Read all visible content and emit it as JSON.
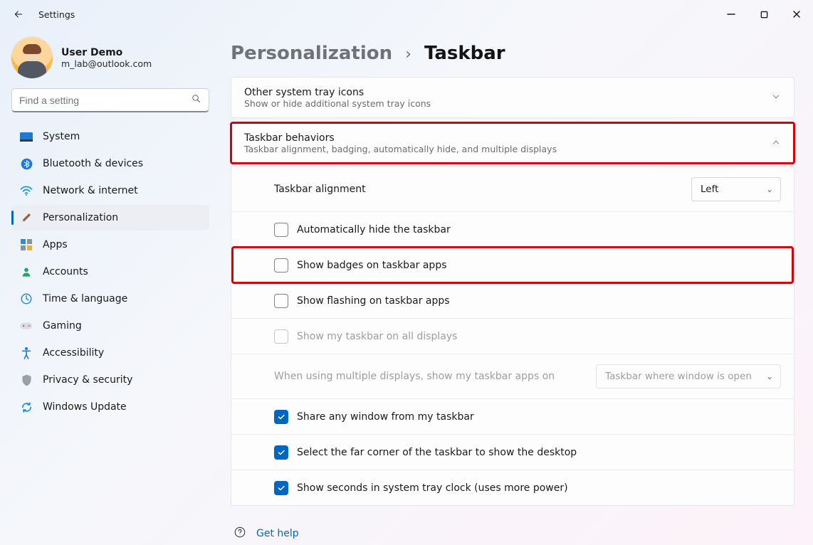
{
  "titlebar": {
    "app_title": "Settings"
  },
  "user": {
    "name": "User Demo",
    "email": "m_lab@outlook.com"
  },
  "search": {
    "placeholder": "Find a setting"
  },
  "sidebar": {
    "items": [
      {
        "label": "System"
      },
      {
        "label": "Bluetooth & devices"
      },
      {
        "label": "Network & internet"
      },
      {
        "label": "Personalization"
      },
      {
        "label": "Apps"
      },
      {
        "label": "Accounts"
      },
      {
        "label": "Time & language"
      },
      {
        "label": "Gaming"
      },
      {
        "label": "Accessibility"
      },
      {
        "label": "Privacy & security"
      },
      {
        "label": "Windows Update"
      }
    ]
  },
  "breadcrumb": {
    "parent": "Personalization",
    "current": "Taskbar"
  },
  "panels": {
    "systray": {
      "title": "Other system tray icons",
      "sub": "Show or hide additional system tray icons"
    },
    "behaviors": {
      "title": "Taskbar behaviors",
      "sub": "Taskbar alignment, badging, automatically hide, and multiple displays"
    }
  },
  "settings": {
    "alignment_label": "Taskbar alignment",
    "alignment_value": "Left",
    "auto_hide": "Automatically hide the taskbar",
    "badges": "Show badges on taskbar apps",
    "flashing": "Show flashing on taskbar apps",
    "all_displays": "Show my taskbar on all displays",
    "multi_label": "When using multiple displays, show my taskbar apps on",
    "multi_value": "Taskbar where window is open",
    "share_window": "Share any window from my taskbar",
    "far_corner": "Select the far corner of the taskbar to show the desktop",
    "seconds": "Show seconds in system tray clock (uses more power)"
  },
  "gethelp": {
    "label": "Get help"
  }
}
